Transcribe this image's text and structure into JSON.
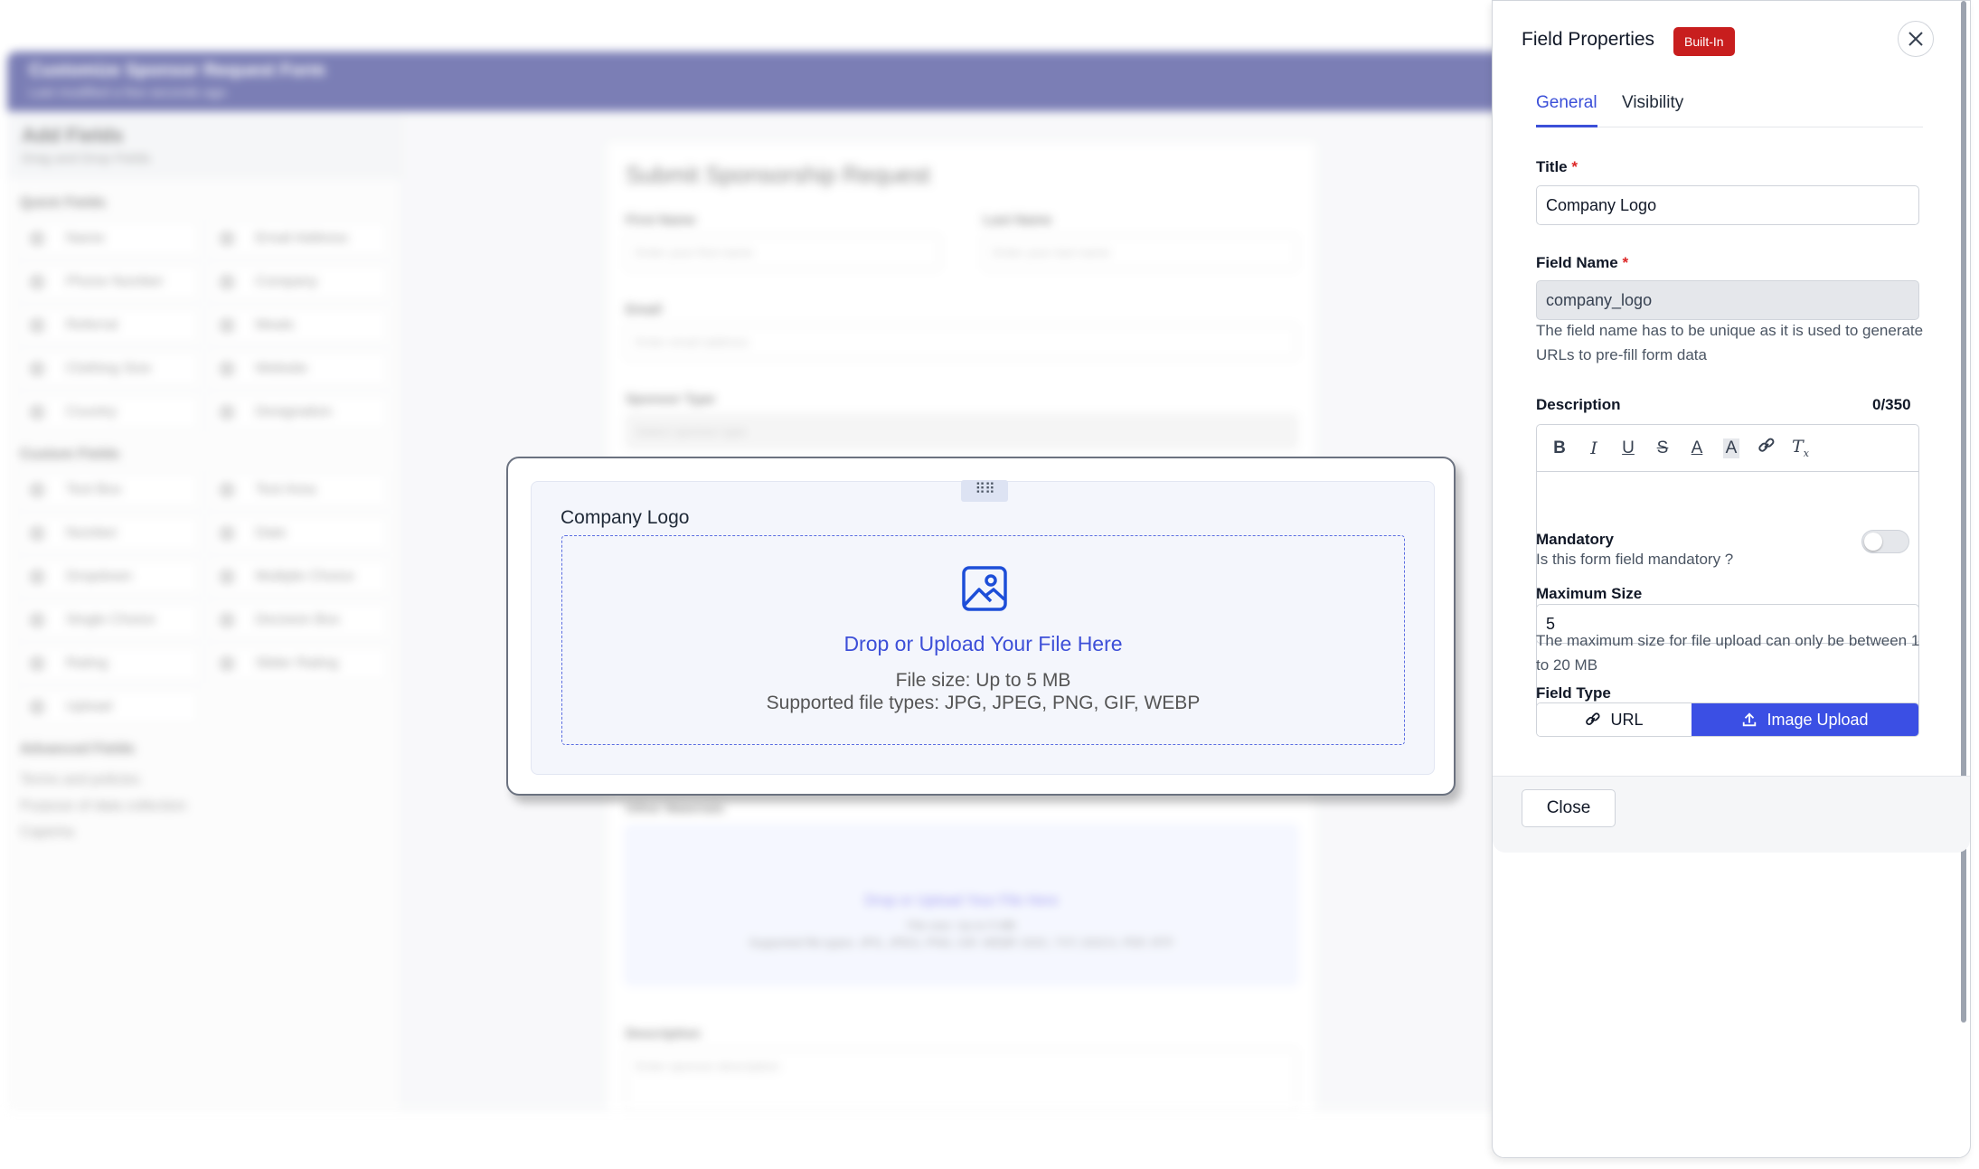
{
  "background": {
    "header_title": "Customize Sponsor Request Form",
    "header_subtitle": "Last modified a few seconds ago",
    "sidebar_title": "Add Fields",
    "sidebar_subtitle": "Drag and Drop Fields",
    "quick_fields_heading": "Quick Fields",
    "quick_fields": [
      "Name",
      "Email Address",
      "Phone Number",
      "Company",
      "Referral",
      "Meals",
      "Clothing Size",
      "Website",
      "Country",
      "Designation"
    ],
    "custom_fields_heading": "Custom Fields",
    "custom_fields": [
      "Text Box",
      "Text Area",
      "Number",
      "Date",
      "Dropdown",
      "Multiple Choice",
      "Single Choice",
      "Decision Box",
      "Rating",
      "Slider Rating",
      "Upload"
    ],
    "advanced_fields_heading": "Advanced Fields",
    "advanced_fields": [
      "Terms and policies",
      "Purpose of data collection",
      "Captcha"
    ],
    "form_title": "Submit Sponsorship Request",
    "first_name_label": "First Name",
    "first_name_placeholder": "Enter your first name",
    "last_name_label": "Last Name",
    "last_name_placeholder": "Enter your last name",
    "email_label": "Email",
    "email_placeholder": "Enter email address",
    "sponsor_type_label": "Sponsor Type",
    "sponsor_type_placeholder": "Select sponsor type",
    "other_materials_label": "Other Materials",
    "other_drop_text": "Drop or Upload Your File Here",
    "other_size": "File size: Up to 5 MB",
    "other_types": "Supported file types: JPG, JPEG, PNG, GIF, WEBP, DOC, TXT, DOCX, PDF, RTF",
    "description_label": "Description",
    "description_placeholder": "Enter sponsor description"
  },
  "card": {
    "drag_handle": "⠿⠿",
    "title": "Company Logo",
    "drop_text": "Drop or Upload Your File Here",
    "file_size": "File size: Up to 5 MB",
    "file_types": "Supported file types: JPG, JPEG, PNG, GIF, WEBP"
  },
  "panel": {
    "title": "Field Properties",
    "badge": "Built-In",
    "tabs": [
      {
        "label": "General",
        "active": true
      },
      {
        "label": "Visibility",
        "active": false
      }
    ],
    "title_label": "Title",
    "title_value": "Company Logo",
    "field_name_label": "Field Name",
    "field_name_value": "company_logo",
    "field_name_help": "The field name has to be unique as it is used to generate URLs to pre-fill form data",
    "description_label": "Description",
    "description_counter": "0/350",
    "mandatory_label": "Mandatory",
    "mandatory_help": "Is this form field mandatory ?",
    "mandatory_on": false,
    "max_size_label": "Maximum Size",
    "max_size_value": "5",
    "max_size_help": "The maximum size for file upload can only be between 1 to 20 MB",
    "field_type_label": "Field Type",
    "field_type_options": [
      "URL",
      "Image Upload"
    ],
    "field_type_selected": "Image Upload",
    "close_label": "Close",
    "required_marker": "*"
  },
  "colors": {
    "accent": "#3b4fe4",
    "badge": "#c81e1e",
    "header": "#10167a"
  }
}
